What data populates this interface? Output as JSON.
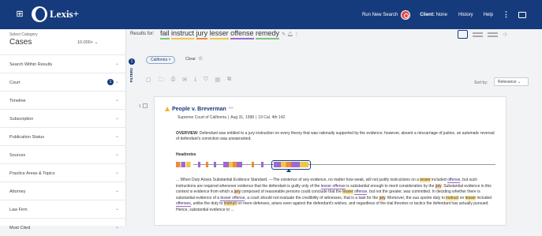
{
  "topbar": {
    "brand": "Lexis+",
    "brand_sup": "",
    "run_new_search": "Run New Search",
    "client_label": "Client:",
    "client_value": "None",
    "history": "History",
    "help": "Help",
    "kebab": "⋮"
  },
  "sidebar": {
    "select_category": "Select Category",
    "category": "Cases",
    "category_count": "10,000+",
    "items": [
      {
        "label": "Search Within Results",
        "badge": ""
      },
      {
        "label": "Court",
        "badge": "1"
      },
      {
        "label": "Timeline",
        "badge": ""
      },
      {
        "label": "Subscription",
        "badge": ""
      },
      {
        "label": "Publication Status",
        "badge": ""
      },
      {
        "label": "Sources",
        "badge": ""
      },
      {
        "label": "Practice Areas & Topics",
        "badge": ""
      },
      {
        "label": "Attorney",
        "badge": ""
      },
      {
        "label": "Law Firm",
        "badge": ""
      },
      {
        "label": "Most Cited",
        "badge": ""
      }
    ]
  },
  "filter_strip": {
    "count": "1",
    "label": "FILTERS"
  },
  "results": {
    "label": "Results for:",
    "query_terms": [
      "fail",
      "instruct",
      "jury",
      "lesser",
      "offense",
      "remedy"
    ],
    "query_colors": [
      "green",
      "yellow",
      "orange",
      "yellow",
      "purple",
      "green"
    ]
  },
  "chips": {
    "active": "California ×",
    "clear": "Clear"
  },
  "sort": {
    "label": "Sort by:",
    "value": "Relevance"
  },
  "card": {
    "title": "People v. Breverman",
    "title_sup": "AA",
    "court": "Supreme Court of California",
    "date": "Aug 31, 1998",
    "cite": "19 Cal. 4th 142",
    "overview_label": "OVERVIEW:",
    "overview_text": "Defendant was entitled to a jury instruction on every theory that was rationally supported by the evidence; however, absent a miscarriage of justice, an automatic reversal of defendant's conviction was unwarranted.",
    "headnotes_label": "Headnotes",
    "excerpt": [
      {
        "t": "... When Duty Arises Substantial Evidence Standard. —The existence of any evidence, no matter how weak, will not justify instructions on a ",
        "c": ""
      },
      {
        "t": "lesser",
        "c": "e-yel"
      },
      {
        "t": " included ",
        "c": ""
      },
      {
        "t": "offense",
        "c": "e-pur"
      },
      {
        "t": ", but such instructions are required whenever evidence that the defendant is guilty only of the ",
        "c": ""
      },
      {
        "t": "lesser offense",
        "c": "e-pur"
      },
      {
        "t": " is substantial enough to merit consideration by the ",
        "c": ""
      },
      {
        "t": "jury",
        "c": "e-org"
      },
      {
        "t": ". Substantial evidence in this context is evidence from which a ",
        "c": ""
      },
      {
        "t": "jury",
        "c": "e-org"
      },
      {
        "t": " composed of reasonable persons could conclude that the ",
        "c": ""
      },
      {
        "t": "lesser",
        "c": "e-yel"
      },
      {
        "t": " ",
        "c": ""
      },
      {
        "t": "offense",
        "c": "e-pur"
      },
      {
        "t": ", but not the greater, was committed. In deciding whether there is substantial evidence of a ",
        "c": ""
      },
      {
        "t": "lesser offense",
        "c": "e-pur"
      },
      {
        "t": ", a court should not evaluate the credibility of witnesses, that is a task for the ",
        "c": ""
      },
      {
        "t": "jury",
        "c": "e-org"
      },
      {
        "t": ". Moreover, the sua sponte duty to ",
        "c": ""
      },
      {
        "t": "instruct",
        "c": "e-yel"
      },
      {
        "t": " on ",
        "c": ""
      },
      {
        "t": "lesser",
        "c": "e-yel"
      },
      {
        "t": " included ",
        "c": ""
      },
      {
        "t": "offenses",
        "c": "e-pur"
      },
      {
        "t": ", unlike the duty to ",
        "c": ""
      },
      {
        "t": "instruct",
        "c": "e-yel"
      },
      {
        "t": " on mere defenses, arises even against the defendant's wishes, and regardless of the trial theories or tactics the defendant has actually pursued. Hence, substantial evidence to ...",
        "c": ""
      }
    ]
  },
  "colors": {
    "topbar": "#163b7d",
    "accent": "#163b7d",
    "hl_green": "#7dc67d",
    "hl_yellow": "#f0c64a",
    "hl_orange": "#f08a3a",
    "hl_purple": "#9a6ad0"
  },
  "icons": [
    "apps-grid-icon",
    "search-icon",
    "more-vert-icon",
    "message-icon",
    "edit-icon",
    "alert-icon",
    "star-icon",
    "folder-icon",
    "print-icon",
    "email-icon",
    "download-icon",
    "bookmark-icon",
    "document-icon",
    "copy-icon",
    "chevron-down-icon",
    "warning-icon"
  ],
  "checkbox_label": "1"
}
